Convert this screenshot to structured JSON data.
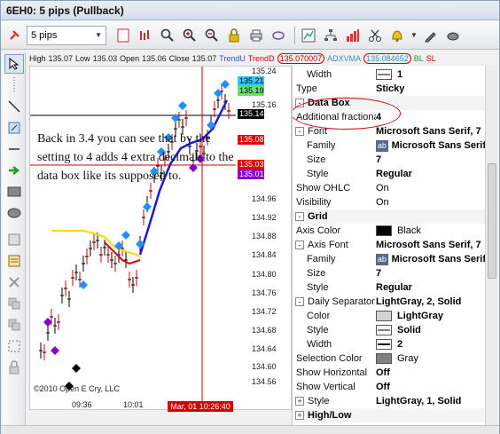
{
  "window": {
    "title": "6EH0: 5 pips (Pullback)"
  },
  "toolbar": {
    "pin_icon": "pin-icon",
    "interval_value": "5 pips",
    "icons": [
      "pin-icon",
      "blank-page-icon",
      "bar-chart-icon",
      "zoom-in-icon",
      "zoom-plus-icon",
      "zoom-minus-icon",
      "lock-icon",
      "printer-icon",
      "trend-icon",
      "chart-color-icon",
      "hierarchy-icon",
      "bar-colors-icon",
      "scissors-icon",
      "bell-icon",
      "pencil-icon",
      "mouse-icon"
    ]
  },
  "infobar": {
    "high_label": "High",
    "high": "135.07",
    "low_label": "Low",
    "low": "135.03",
    "open_label": "Open",
    "open": "135.06",
    "close_label": "Close",
    "close": "135.07",
    "trendu": "TrendU",
    "trendd": "TrendD",
    "trendd_value": "135.070007",
    "adxvma": "ADXVMA",
    "adxvma_value": "135.084652",
    "bl": "BL",
    "sl": "SL"
  },
  "price_axis": [
    "135.24",
    "135.16",
    "134.96",
    "134.92",
    "134.88",
    "134.84",
    "134.80",
    "134.76",
    "134.72",
    "134.68",
    "134.64",
    "134.60",
    "134.56"
  ],
  "price_boxes": [
    {
      "text": "135.21",
      "color": "#30c8ff"
    },
    {
      "text": "135.19",
      "color": "#6be06b"
    },
    {
      "text": "135.14",
      "color": "#000000"
    },
    {
      "text": "135.08",
      "color": "#e00000"
    },
    {
      "text": "135.03",
      "color": "#e00000"
    },
    {
      "text": "135.01",
      "color": "#8800cc"
    }
  ],
  "annotation": "Back in 3.4 you can see that by the setting to 4 adds 4 extra decimals to the data box like its supposed to.",
  "copyright": "©2010 Open E Cry, LLC",
  "time_axis": {
    "t1": "09:36",
    "t2": "10:01",
    "cursor_time": "Mar, 01 10:26:40"
  },
  "properties": {
    "rows": [
      {
        "type": "prop",
        "key": "Width",
        "val": "1",
        "sub": true,
        "widget": "line"
      },
      {
        "type": "prop",
        "key": "Type",
        "val": "Sticky",
        "sub": false
      },
      {
        "type": "cat",
        "key": "Data Box",
        "exp": "-"
      },
      {
        "type": "prop",
        "key": "Additional fractional",
        "val": "4",
        "sub": false
      },
      {
        "type": "prop",
        "key": "Font",
        "val": "Microsoft Sans Serif, 7",
        "sub": false,
        "exp": "-"
      },
      {
        "type": "prop",
        "key": "Family",
        "val": "Microsoft Sans Serif",
        "sub": true,
        "widget": "font"
      },
      {
        "type": "prop",
        "key": "Size",
        "val": "7",
        "sub": true
      },
      {
        "type": "prop",
        "key": "Style",
        "val": "Regular",
        "sub": true
      },
      {
        "type": "prop",
        "key": "Show OHLC",
        "val": "On",
        "sub": false,
        "norm": true
      },
      {
        "type": "prop",
        "key": "Visibility",
        "val": "On",
        "sub": false,
        "norm": true
      },
      {
        "type": "cat",
        "key": "Grid",
        "exp": "-"
      },
      {
        "type": "prop",
        "key": "Axis Color",
        "val": "Black",
        "sub": false,
        "norm": true,
        "widget": "swatch",
        "swatch": "#000000"
      },
      {
        "type": "prop",
        "key": "Axis Font",
        "val": "Microsoft Sans Serif, 7",
        "sub": false,
        "exp": "-"
      },
      {
        "type": "prop",
        "key": "Family",
        "val": "Microsoft Sans Serif",
        "sub": true,
        "widget": "font"
      },
      {
        "type": "prop",
        "key": "Size",
        "val": "7",
        "sub": true
      },
      {
        "type": "prop",
        "key": "Style",
        "val": "Regular",
        "sub": true
      },
      {
        "type": "prop",
        "key": "Daily Separator",
        "val": "LightGray, 2, Solid",
        "sub": false,
        "exp": "-"
      },
      {
        "type": "prop",
        "key": "Color",
        "val": "LightGray",
        "sub": true,
        "widget": "swatch",
        "swatch": "#d3d3d3"
      },
      {
        "type": "prop",
        "key": "Style",
        "val": "Solid",
        "sub": true,
        "widget": "line"
      },
      {
        "type": "prop",
        "key": "Width",
        "val": "2",
        "sub": true,
        "widget": "line"
      },
      {
        "type": "prop",
        "key": "Selection Color",
        "val": "Gray",
        "sub": false,
        "norm": true,
        "widget": "swatch",
        "swatch": "#808080"
      },
      {
        "type": "prop",
        "key": "Show Horizontal",
        "val": "Off",
        "sub": false
      },
      {
        "type": "prop",
        "key": "Show Vertical",
        "val": "Off",
        "sub": false
      },
      {
        "type": "prop",
        "key": "Style",
        "val": "LightGray, 1, Solid",
        "sub": false,
        "exp": "+"
      },
      {
        "type": "cat",
        "key": "High/Low",
        "exp": "+"
      }
    ]
  }
}
